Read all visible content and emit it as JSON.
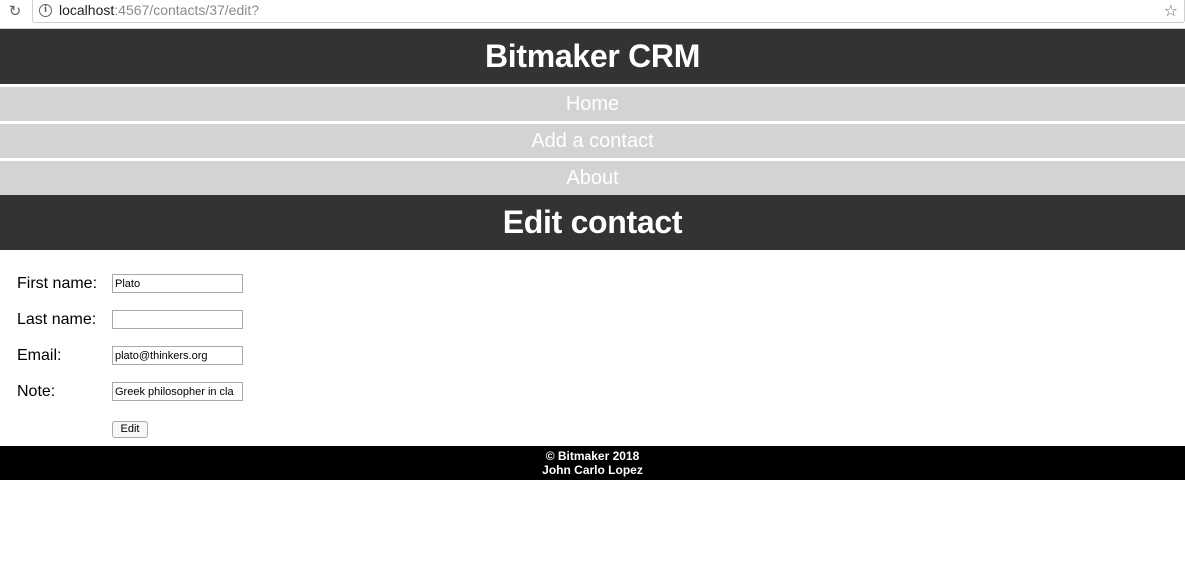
{
  "browser": {
    "url_host": "localhost",
    "url_rest": ":4567/contacts/37/edit?"
  },
  "header": {
    "title": "Bitmaker CRM"
  },
  "nav": {
    "items": [
      {
        "label": "Home"
      },
      {
        "label": "Add a contact"
      },
      {
        "label": "About"
      }
    ]
  },
  "page": {
    "heading": "Edit contact"
  },
  "form": {
    "fields": [
      {
        "label": "First name:",
        "value": "Plato"
      },
      {
        "label": "Last name:",
        "value": ""
      },
      {
        "label": "Email:",
        "value": "plato@thinkers.org"
      },
      {
        "label": "Note:",
        "value": "Greek philosopher in cla"
      }
    ],
    "submit_label": "Edit"
  },
  "footer": {
    "copyright": "© Bitmaker 2018",
    "author": "John Carlo Lopez"
  }
}
